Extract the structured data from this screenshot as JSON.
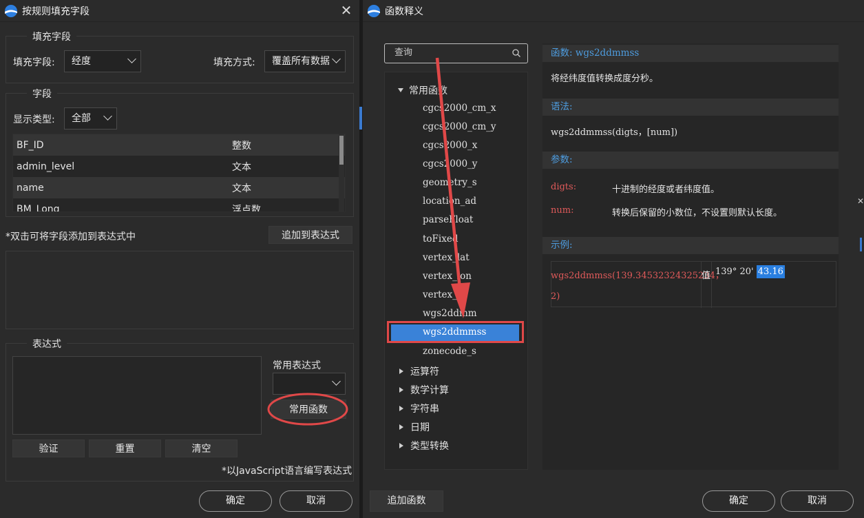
{
  "left_dialog": {
    "title": "按规则填充字段",
    "fill_group": {
      "title": "填充字段",
      "field_label": "填充字段:",
      "field_value": "经度",
      "mode_label": "填充方式:",
      "mode_value": "覆盖所有数据"
    },
    "field_group": {
      "title": "字段",
      "display_type_label": "显示类型:",
      "display_type_value": "全部",
      "rows": [
        {
          "name": "BF_ID",
          "type": "整数"
        },
        {
          "name": "admin_level",
          "type": "文本"
        },
        {
          "name": "name",
          "type": "文本"
        },
        {
          "name": "BM_Long",
          "type": "浮点数"
        }
      ]
    },
    "hint": "*双击可将字段添加到表达式中",
    "append_button": "追加到表达式",
    "expr_group": {
      "title": "表达式",
      "common_expr_label": "常用表达式",
      "common_func_button": "常用函数",
      "validate": "验证",
      "reset": "重置",
      "clear": "清空",
      "note": "*以JavaScript语言编写表达式"
    },
    "ok": "确定",
    "cancel": "取消"
  },
  "right_dialog": {
    "title": "函数释义",
    "search_placeholder": "查询",
    "tree": {
      "common_label": "常用函数",
      "functions": [
        "cgcs2000_cm_x",
        "cgcs2000_cm_y",
        "cgcs2000_x",
        "cgcs2000_y",
        "geometry_s",
        "location_ad",
        "parseFloat",
        "toFixed",
        "vertex_lat",
        "vertex_lon",
        "vertex_",
        "wgs2ddmm",
        "wgs2ddmmss",
        "zonecode_s"
      ],
      "categories": [
        "运算符",
        "数学计算",
        "字符串",
        "日期",
        "类型转换"
      ]
    },
    "detail": {
      "func_header": "函数: wgs2ddmmss",
      "description": "将经纬度值转换成度分秒。",
      "syntax_header": "语法:",
      "syntax": "wgs2ddmmss(digts，[num])",
      "params_header": "参数:",
      "params": [
        {
          "name": "digts:",
          "desc": "十进制的经度或者纬度值。"
        },
        {
          "name": "num:",
          "desc": "转换后保留的小数位，不设置则默认长度。"
        }
      ],
      "example_header": "示例:",
      "example_expr_1": "wgs2ddmmss(139.34532324325234，",
      "example_expr_2": "2)",
      "example_value_label": "值",
      "example_result_plain": "139° 20'",
      "example_result_hl": "43.16"
    },
    "add_function": "追加函数",
    "ok": "确定",
    "cancel": "取消"
  },
  "colors": {
    "accent_blue": "#3a82d8",
    "annotation_red": "#e04848",
    "section_header_blue": "#4e9de0",
    "param_red": "#e05a5a"
  }
}
